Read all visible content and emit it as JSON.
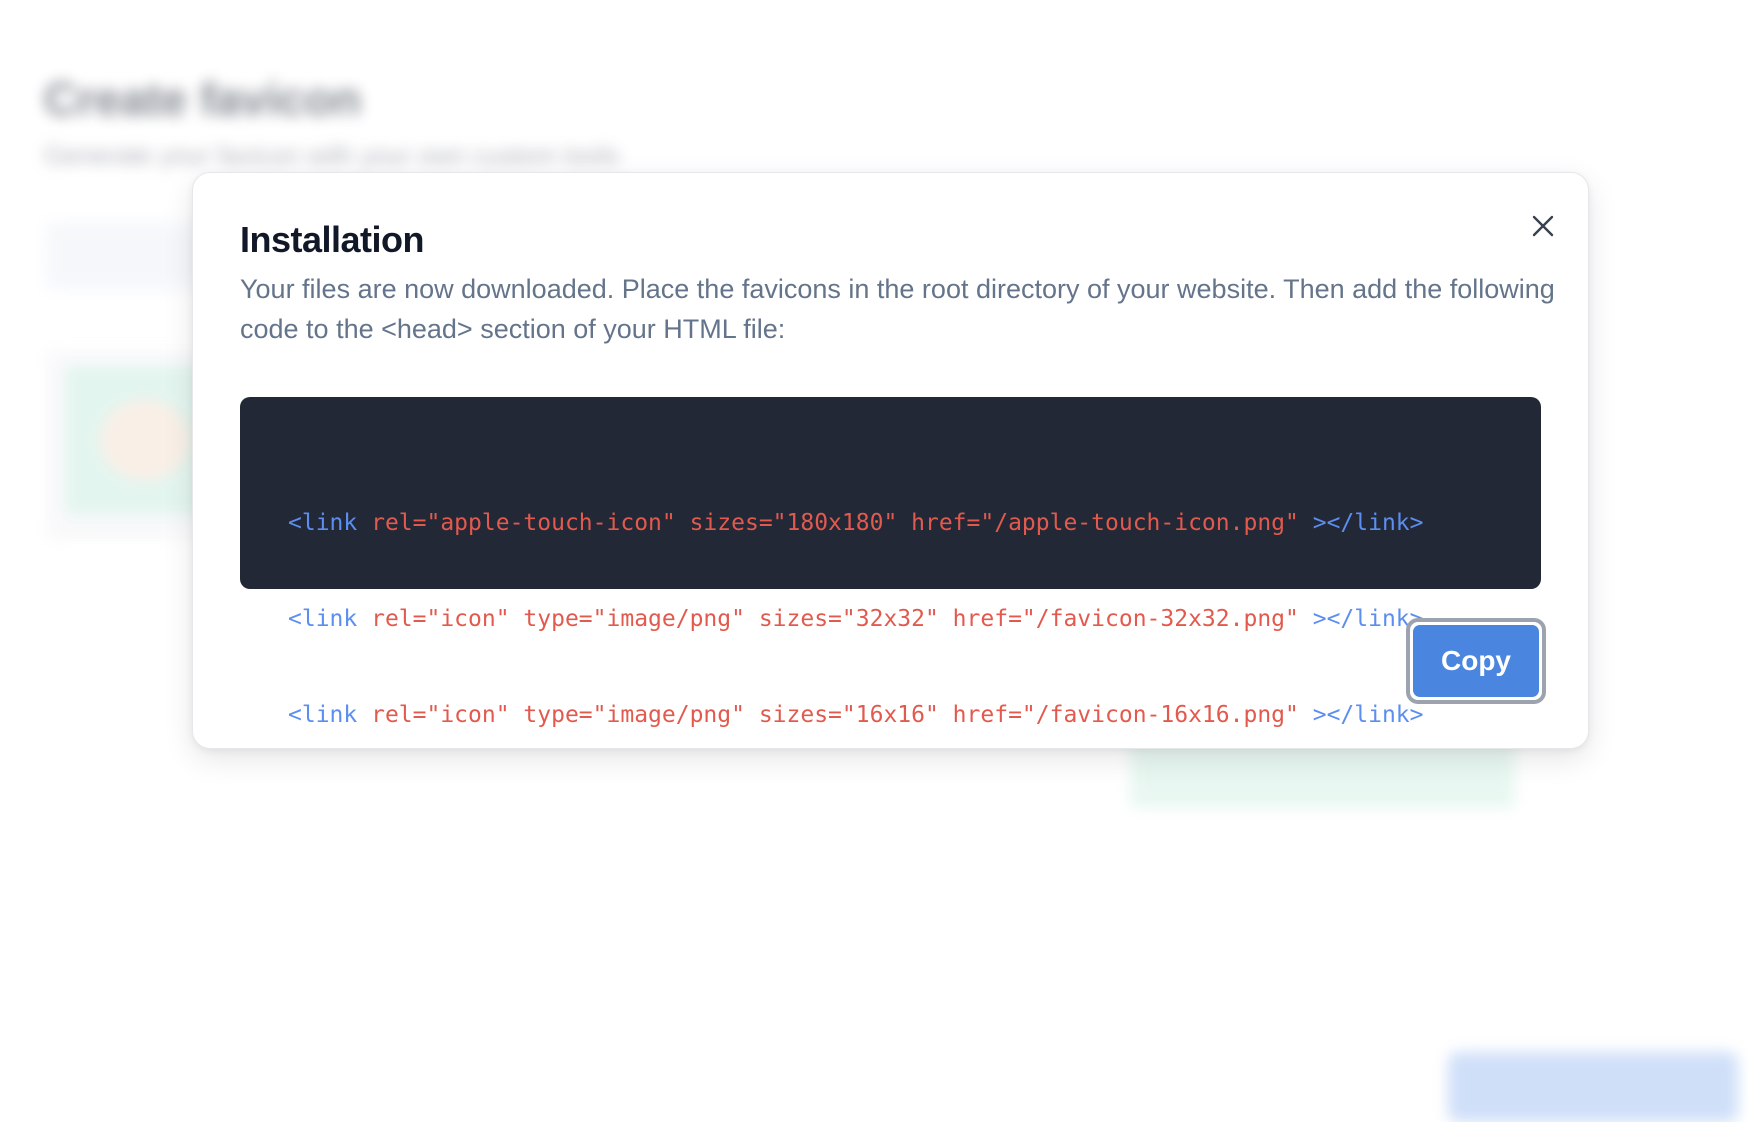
{
  "background": {
    "title": "Create favicon",
    "subtitle": "Generate your favicon with your own custom tools"
  },
  "modal": {
    "title": "Installation",
    "description": "Your files are now downloaded. Place the favicons in the root directory of your website. Then add the following code to the <head> section of your HTML file:",
    "close_icon": "close-icon",
    "code_lines": [
      {
        "open": "<link",
        "attrs": " rel=\"apple-touch-icon\" sizes=\"180x180\" href=\"/apple-touch-icon.png\" ",
        "close": "></link>"
      },
      {
        "open": "<link",
        "attrs": " rel=\"icon\" type=\"image/png\" sizes=\"32x32\" href=\"/favicon-32x32.png\" ",
        "close": "></link>"
      },
      {
        "open": "<link",
        "attrs": " rel=\"icon\" type=\"image/png\" sizes=\"16x16\" href=\"/favicon-16x16.png\" ",
        "close": "></link>"
      }
    ],
    "copy_label": "Copy"
  },
  "colors": {
    "code_background": "#222836",
    "code_tag": "#5b8ef0",
    "code_attribute": "#e25a4e",
    "primary_button": "#4a86df"
  }
}
